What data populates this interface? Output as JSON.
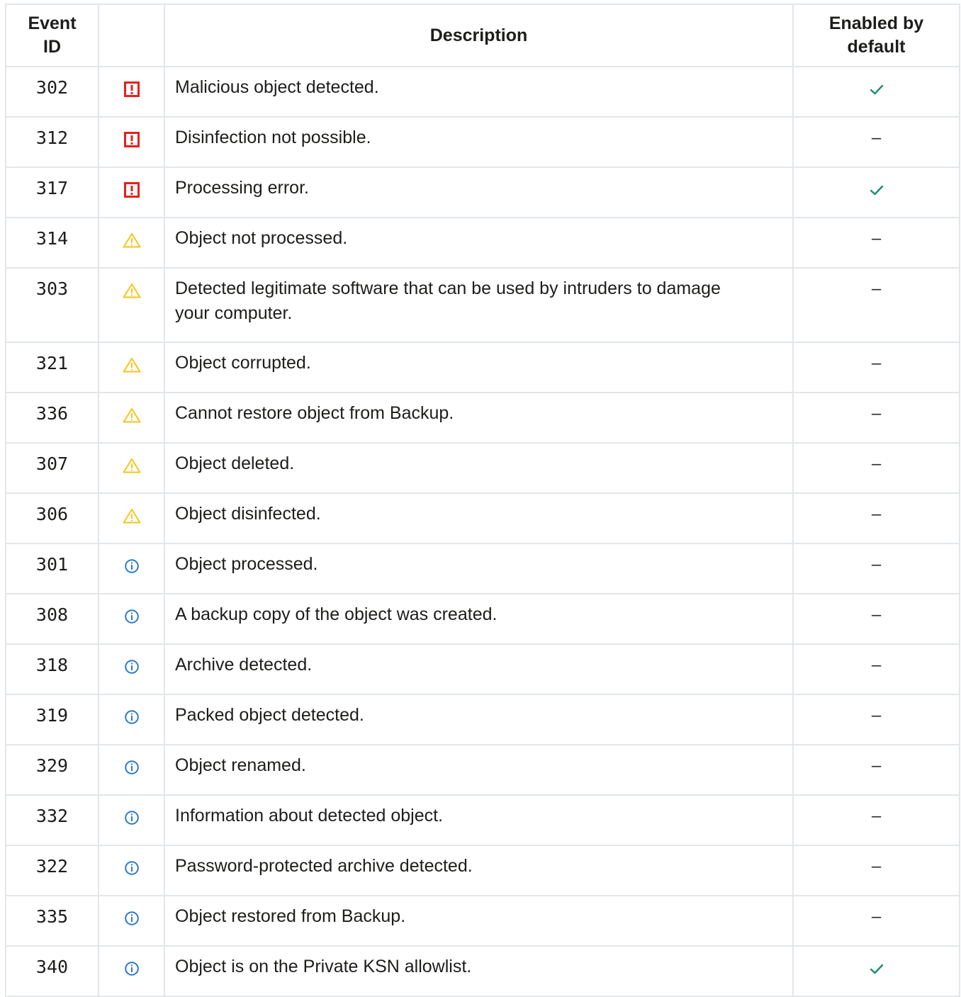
{
  "headers": {
    "event_id": "Event ID",
    "severity": "",
    "description": "Description",
    "enabled": "Enabled by default"
  },
  "severity_icons": {
    "error": "error-icon",
    "warning": "warning-icon",
    "info": "info-icon"
  },
  "colors": {
    "error": "#e4221b",
    "warning": "#f5c518",
    "info": "#2b7bc8",
    "check": "#1a8c74",
    "border": "#e3e6ea"
  },
  "rows": [
    {
      "id": "302",
      "severity": "error",
      "description": "Malicious object detected.",
      "enabled": true
    },
    {
      "id": "312",
      "severity": "error",
      "description": "Disinfection not possible.",
      "enabled": false
    },
    {
      "id": "317",
      "severity": "error",
      "description": "Processing error.",
      "enabled": true
    },
    {
      "id": "314",
      "severity": "warning",
      "description": "Object not processed.",
      "enabled": false
    },
    {
      "id": "303",
      "severity": "warning",
      "description": "Detected legitimate software that can be used by intruders to damage your computer.",
      "enabled": false
    },
    {
      "id": "321",
      "severity": "warning",
      "description": "Object corrupted.",
      "enabled": false
    },
    {
      "id": "336",
      "severity": "warning",
      "description": "Cannot restore object from Backup.",
      "enabled": false
    },
    {
      "id": "307",
      "severity": "warning",
      "description": "Object deleted.",
      "enabled": false
    },
    {
      "id": "306",
      "severity": "warning",
      "description": "Object disinfected.",
      "enabled": false
    },
    {
      "id": "301",
      "severity": "info",
      "description": "Object processed.",
      "enabled": false
    },
    {
      "id": "308",
      "severity": "info",
      "description": "A backup copy of the object was created.",
      "enabled": false
    },
    {
      "id": "318",
      "severity": "info",
      "description": "Archive detected.",
      "enabled": false
    },
    {
      "id": "319",
      "severity": "info",
      "description": "Packed object detected.",
      "enabled": false
    },
    {
      "id": "329",
      "severity": "info",
      "description": "Object renamed.",
      "enabled": false
    },
    {
      "id": "332",
      "severity": "info",
      "description": "Information about detected object.",
      "enabled": false
    },
    {
      "id": "322",
      "severity": "info",
      "description": "Password-protected archive detected.",
      "enabled": false
    },
    {
      "id": "335",
      "severity": "info",
      "description": "Object restored from Backup.",
      "enabled": false
    },
    {
      "id": "340",
      "severity": "info",
      "description": "Object is on the Private KSN allowlist.",
      "enabled": true
    }
  ],
  "disabled_mark": "–"
}
